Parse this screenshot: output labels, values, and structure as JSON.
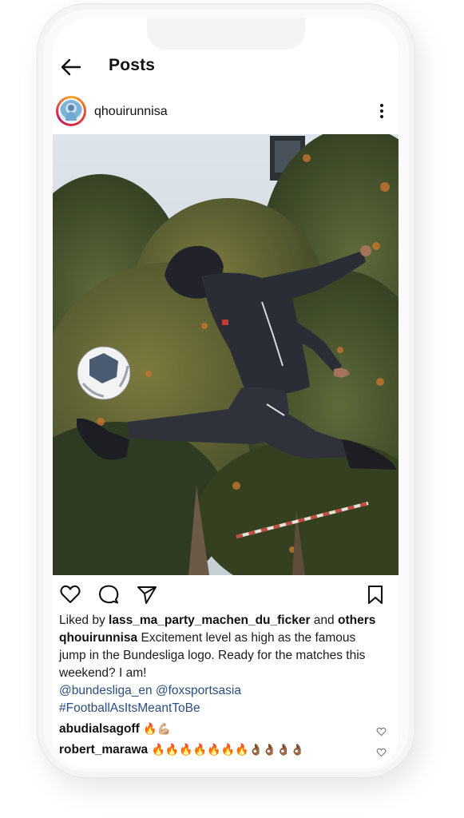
{
  "header": {
    "title": "Posts"
  },
  "post": {
    "username": "qhouirunnisa",
    "likes": {
      "prefix": "Liked by ",
      "user": "lass_ma_party_machen_du_ficker",
      "middle": " and ",
      "others": "others"
    },
    "caption": {
      "user": "qhouirunnisa",
      "text_line1": " Excitement level as high as the famous",
      "text_line2": "jump in the Bundesliga logo. Ready for the matches this",
      "text_line3": "weekend? I am!",
      "mention1": "@bundesliga_en",
      "mention2": "@foxsportsasia",
      "hashtag": "#FootballAsItsMeantToBe"
    },
    "comments": [
      {
        "user": "abudialsagoff",
        "text": "🔥💪🏼"
      },
      {
        "user": "robert_marawa",
        "text": "🔥🔥🔥🔥🔥🔥🔥👌🏾👌🏾👌🏾👌🏾"
      }
    ]
  },
  "icons": {
    "back": "arrow-left-icon",
    "more": "vertical-dots-icon",
    "like": "heart-icon",
    "comment": "speech-bubble-icon",
    "share": "paper-plane-icon",
    "save": "bookmark-icon"
  },
  "colors": {
    "link": "#2a4e7e",
    "story_ring_start": "#f9a825",
    "story_ring_end": "#c2185b"
  }
}
